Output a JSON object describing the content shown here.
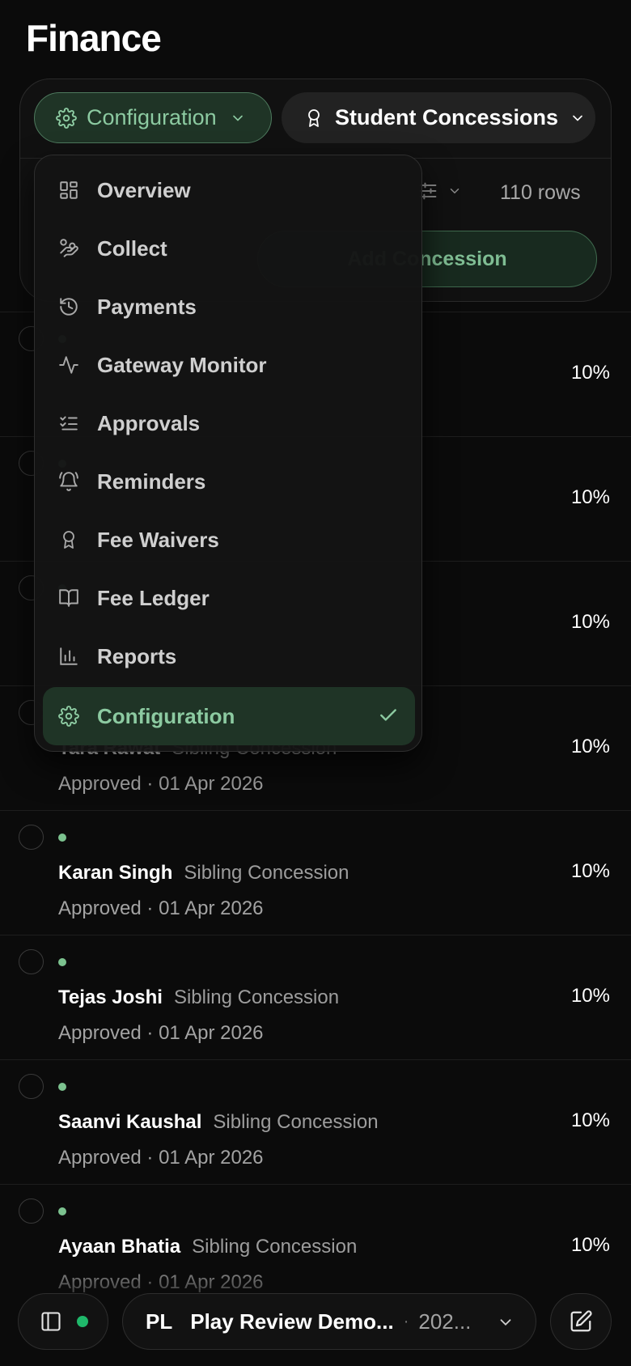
{
  "header": {
    "title": "Finance"
  },
  "toolbar": {
    "section_label": "Configuration",
    "page_label": "Student Concessions",
    "rows_count": "110 rows",
    "add_label": "Add Concession"
  },
  "menu": {
    "items": [
      {
        "label": "Overview",
        "icon": "grid-icon"
      },
      {
        "label": "Collect",
        "icon": "hand-coins-icon"
      },
      {
        "label": "Payments",
        "icon": "history-icon"
      },
      {
        "label": "Gateway Monitor",
        "icon": "activity-icon"
      },
      {
        "label": "Approvals",
        "icon": "list-checks-icon"
      },
      {
        "label": "Reminders",
        "icon": "bell-icon"
      },
      {
        "label": "Fee Waivers",
        "icon": "award-icon"
      },
      {
        "label": "Fee Ledger",
        "icon": "book-open-icon"
      },
      {
        "label": "Reports",
        "icon": "bar-chart-icon"
      },
      {
        "label": "Configuration",
        "icon": "gear-icon",
        "selected": true
      }
    ]
  },
  "rows": [
    {
      "name": "",
      "type": "",
      "status": "",
      "percent": "10%"
    },
    {
      "name": "",
      "type": "",
      "status": "",
      "percent": "10%"
    },
    {
      "name": "",
      "type": "",
      "status": "",
      "percent": "10%"
    },
    {
      "name": "Tara Rawat",
      "type": "Sibling Concession",
      "status": "Approved · 01 Apr 2026",
      "percent": "10%"
    },
    {
      "name": "Karan Singh",
      "type": "Sibling Concession",
      "status": "Approved · 01 Apr 2026",
      "percent": "10%"
    },
    {
      "name": "Tejas Joshi",
      "type": "Sibling Concession",
      "status": "Approved · 01 Apr 2026",
      "percent": "10%"
    },
    {
      "name": "Saanvi Kaushal",
      "type": "Sibling Concession",
      "status": "Approved · 01 Apr 2026",
      "percent": "10%"
    },
    {
      "name": "Ayaan Bhatia",
      "type": "Sibling Concession",
      "status": "Approved · 01 Apr 2026",
      "percent": "10%"
    }
  ],
  "bottom_bar": {
    "org_initials": "PL",
    "org_name": "Play Review Demo...",
    "org_separator": "·",
    "org_year": "202..."
  },
  "colors": {
    "accent_green": "#8ccaa1",
    "status_dot": "#1fb86a",
    "background": "#0b0b0b"
  }
}
